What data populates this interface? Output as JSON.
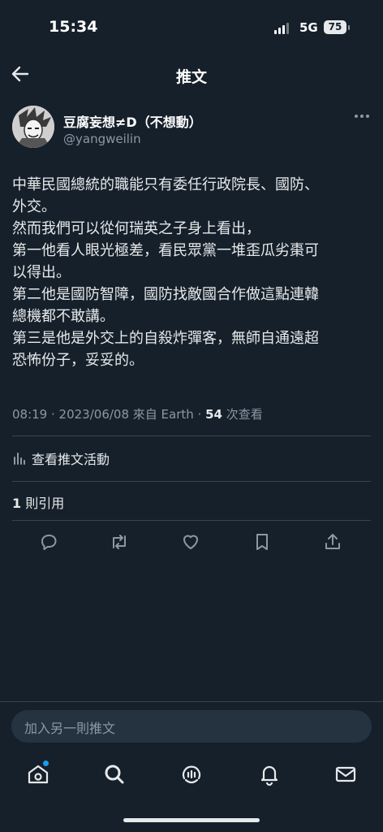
{
  "status_bar": {
    "time": "15:34",
    "network": "5G",
    "battery": "75"
  },
  "header": {
    "title": "推文"
  },
  "author": {
    "name": "豆腐妄想≠D（不想動）",
    "handle": "@yangweilin"
  },
  "tweet": {
    "lines": [
      "中華民國總統的職能只有委任行政院長、國防、",
      "外交。",
      "然而我們可以從何瑞英之子身上看出，",
      "第一他看人眼光極差，看民眾黨一堆歪瓜劣棗可",
      "以得出。",
      "第二他是國防智障，國防找敵國合作做這點連韓",
      "總機都不敢講。",
      "第三是他是外交上的自殺炸彈客，無師自通遠超",
      "恐怖份子，妥妥的。"
    ]
  },
  "meta": {
    "time": "08:19",
    "sep1": " · ",
    "date": "2023/06/08",
    "source": " 來自 Earth",
    "sep2": " · ",
    "views": "54",
    "views_label": " 次查看"
  },
  "activity": {
    "label": "查看推文活動"
  },
  "quotes": {
    "count": "1",
    "label": " 則引用"
  },
  "reply": {
    "placeholder": "加入另一則推文"
  },
  "icons": {
    "back": "arrow-left-icon",
    "more": "more-icon",
    "reply": "reply-icon",
    "retweet": "retweet-icon",
    "like": "heart-icon",
    "bookmark": "bookmark-icon",
    "share": "share-icon",
    "home": "home-icon",
    "search": "search-icon",
    "spaces": "spaces-icon",
    "notifications": "bell-icon",
    "messages": "mail-icon"
  },
  "colors": {
    "background": "#15202b",
    "accent": "#1d9bf0",
    "secondary_text": "#8b98a5"
  }
}
